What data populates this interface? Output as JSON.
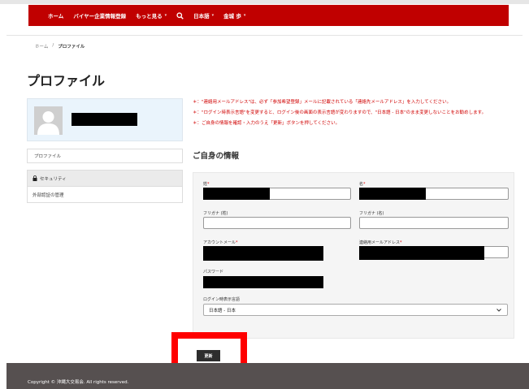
{
  "nav": {
    "items": [
      {
        "label": "ホーム",
        "caret": false
      },
      {
        "label": "バイヤー企業情報登録",
        "caret": false
      },
      {
        "label": "もっと見る",
        "caret": true
      }
    ],
    "language": "日本語",
    "user": "金城 歩",
    "caret_glyph": "▾"
  },
  "breadcrumb": {
    "home": "ホーム",
    "separator": "/",
    "current": "プロファイル"
  },
  "page_title": "プロファイル",
  "sidebar": {
    "profile_label": "プロファイル",
    "security_label": "セキュリティ",
    "external_auth_label": "外部認証の管理"
  },
  "notices": [
    "＊：\"連絡用メールアドレス\"は、必ず「参加希望登録」メールに記載されている「連絡先メールアドレス」を入力してください。",
    "＊：\"ログイン時表示言語\"を変更すると、ログイン後の画面の表示言語が変わりますので、\"日本語 - 日本\"のまま変更しないことをお勧めします。",
    "＊：ご自身の情報を確認・入力のうえ「更新」ボタンを押してください。"
  ],
  "section_title": "ご自身の情報",
  "form": {
    "last_name_label": "姓",
    "first_name_label": "名",
    "last_kana_label": "フリガナ (姓)",
    "first_kana_label": "フリガナ (名)",
    "account_email_label": "アカウントメール",
    "contact_email_label": "連絡用メールアドレス",
    "password_label": "パスワード",
    "language_label": "ログイン時表示言語",
    "language_value": "日本語 - 日本",
    "required_mark": "*"
  },
  "update_button": "更新",
  "footer": "Copyright © 沖縄大交易会. All rights reserved.",
  "colors": {
    "nav": "#c00000",
    "notice": "#d00000",
    "highlight": "#ff0000",
    "footer": "#565050"
  }
}
